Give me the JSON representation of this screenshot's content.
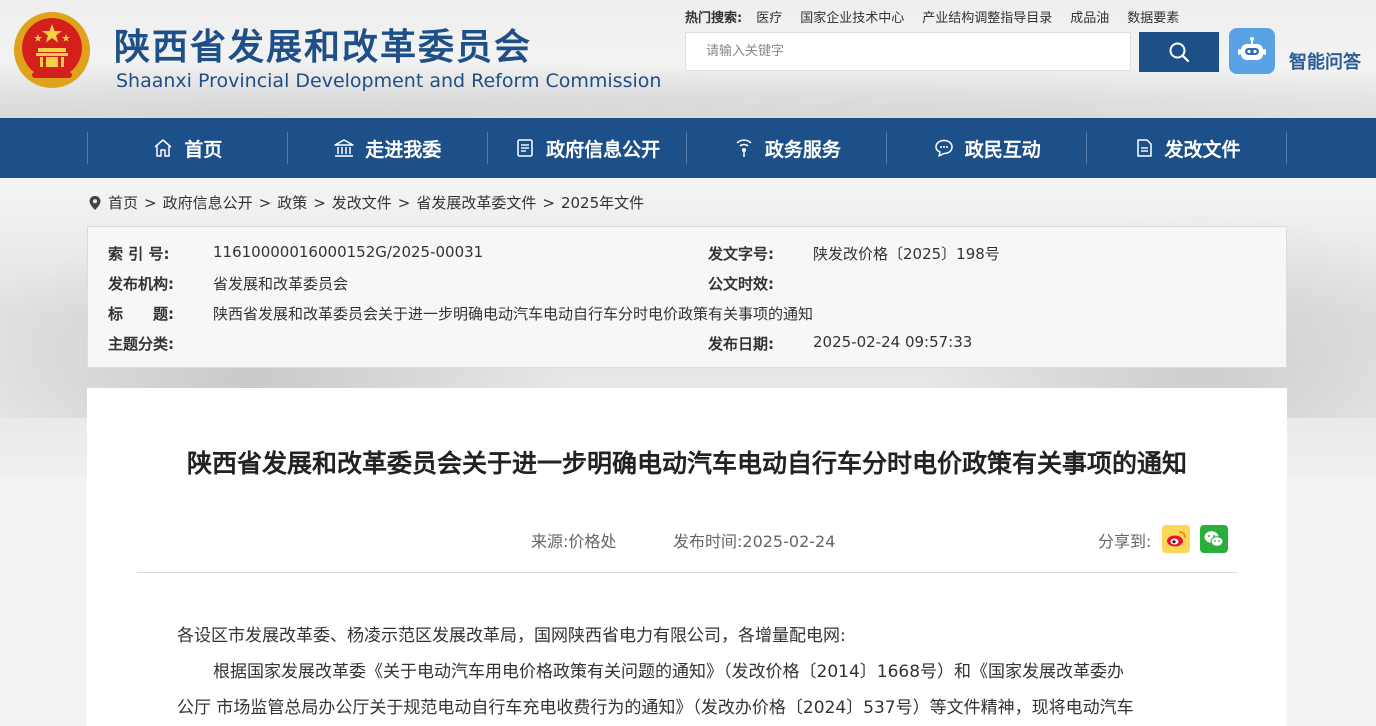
{
  "header": {
    "title_cn": "陕西省发展和改革委员会",
    "title_en": "Shaanxi Provincial Development and Reform Commission",
    "hot_search_label": "热门搜索:",
    "hot_search_items": [
      "医疗",
      "国家企业技术中心",
      "产业结构调整指导目录",
      "成品油",
      "数据要素"
    ],
    "search_placeholder": "请输入关键字",
    "ai_label": "智能问答"
  },
  "nav": {
    "items": [
      {
        "label": "首页",
        "icon": "home-icon"
      },
      {
        "label": "走进我委",
        "icon": "building-icon"
      },
      {
        "label": "政府信息公开",
        "icon": "document-icon"
      },
      {
        "label": "政务服务",
        "icon": "signal-icon"
      },
      {
        "label": "政民互动",
        "icon": "chat-icon"
      },
      {
        "label": "发改文件",
        "icon": "file-icon"
      }
    ]
  },
  "breadcrumb": [
    "首页",
    "政府信息公开",
    "政策",
    "发改文件",
    "省发展改革委文件",
    "2025年文件"
  ],
  "meta": {
    "index_label": "索 引 号:",
    "index_value": "11610000016000152G/2025-00031",
    "docno_label": "发文字号:",
    "docno_value": "陕发改价格〔2025〕198号",
    "issuer_label": "发布机构:",
    "issuer_value": "省发展和改革委员会",
    "validity_label": "公文时效:",
    "validity_value": "",
    "title_label": "标　　题:",
    "title_value": "陕西省发展和改革委员会关于进一步明确电动汽车电动自行车分时电价政策有关事项的通知",
    "topic_label": "主题分类:",
    "topic_value": "",
    "date_label": "发布日期:",
    "date_value": "2025-02-24 09:57:33"
  },
  "article": {
    "title": "陕西省发展和改革委员会关于进一步明确电动汽车电动自行车分时电价政策有关事项的通知",
    "source": "来源:价格处",
    "publish_time": "发布时间:2025-02-24",
    "share_label": "分享到:",
    "paragraphs": [
      "各设区市发展改革委、杨凌示范区发展改革局，国网陕西省电力有限公司，各增量配电网:",
      "根据国家发展改革委《关于电动汽车用电价格政策有关问题的通知》（发改价格〔2014〕1668号）和《国家发展改革委办",
      "公厅 市场监管总局办公厅关于规范电动自行车充电收费行为的通知》（发改办价格〔2024〕537号）等文件精神，现将电动汽车"
    ]
  },
  "colors": {
    "brand_blue": "#1d5088",
    "title_blue": "#1e4f86",
    "weibo_yellow": "#fbd75a",
    "wechat_green": "#2bae3b"
  }
}
